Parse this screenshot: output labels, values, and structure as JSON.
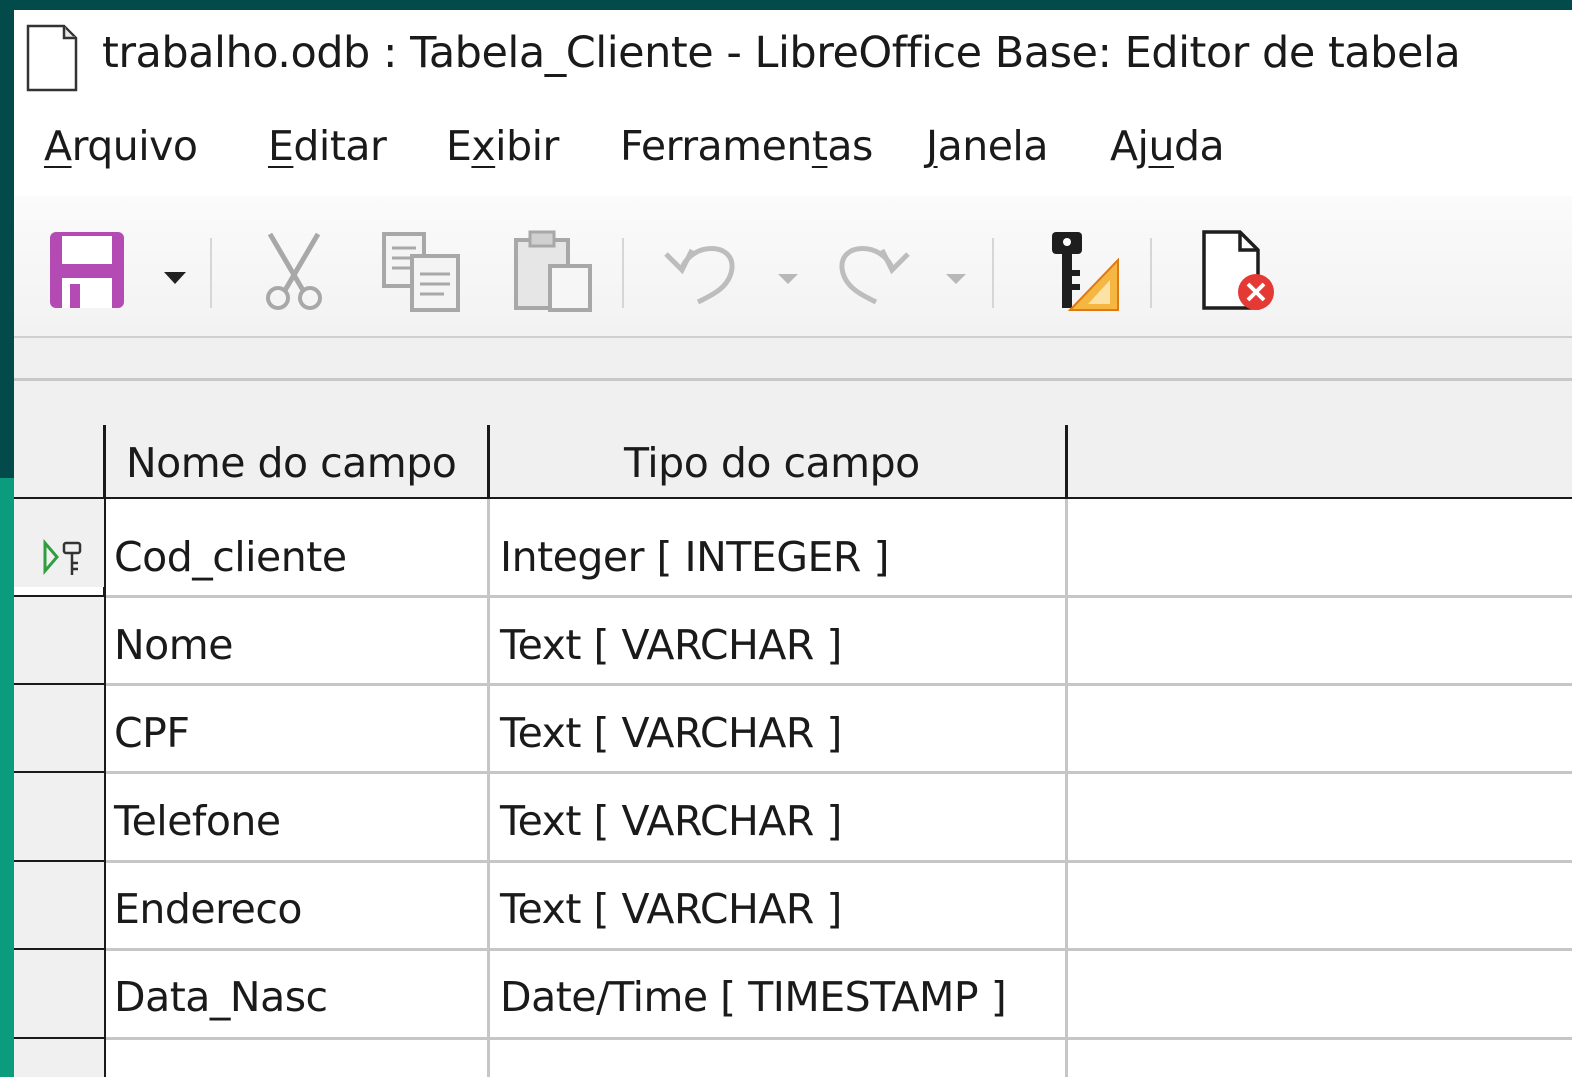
{
  "window": {
    "title": "trabalho.odb : Tabela_Cliente - LibreOffice Base: Editor de tabela"
  },
  "menu": [
    {
      "label": "Arquivo",
      "accel": "A",
      "rest": "rquivo",
      "pre": ""
    },
    {
      "label": "Editar",
      "accel": "E",
      "rest": "ditar",
      "pre": ""
    },
    {
      "label": "Exibir",
      "accel": "x",
      "rest": "ibir",
      "pre": "E"
    },
    {
      "label": "Ferramentas",
      "accel": "t",
      "rest": "as",
      "pre": "Ferramen"
    },
    {
      "label": "Janela",
      "accel": "J",
      "rest": "anela",
      "pre": ""
    },
    {
      "label": "Ajuda",
      "accel": "u",
      "rest": "da",
      "pre": "Aj"
    }
  ],
  "toolbar": {
    "buttons": [
      "save-icon",
      "save-dropdown-icon",
      "cut-icon",
      "copy-icon",
      "paste-icon",
      "undo-icon",
      "undo-dropdown-icon",
      "redo-icon",
      "redo-dropdown-icon",
      "index-design-icon",
      "close-document-icon"
    ]
  },
  "grid": {
    "columns": [
      "Nome do campo",
      "Tipo do campo"
    ],
    "rows": [
      {
        "name": "Cod_cliente",
        "type": "Integer [ INTEGER ]",
        "primary_key": true
      },
      {
        "name": "Nome",
        "type": "Text [ VARCHAR ]",
        "primary_key": false
      },
      {
        "name": "CPF",
        "type": "Text [ VARCHAR ]",
        "primary_key": false
      },
      {
        "name": "Telefone",
        "type": "Text [ VARCHAR ]",
        "primary_key": false
      },
      {
        "name": "Endereco",
        "type": "Text [ VARCHAR ]",
        "primary_key": false
      },
      {
        "name": "Data_Nasc",
        "type": "Date/Time [ TIMESTAMP ]",
        "primary_key": false
      }
    ]
  },
  "colors": {
    "save_accent": "#b44ab3",
    "indicator_green": "#2f9e3f",
    "close_red": "#e53935"
  }
}
